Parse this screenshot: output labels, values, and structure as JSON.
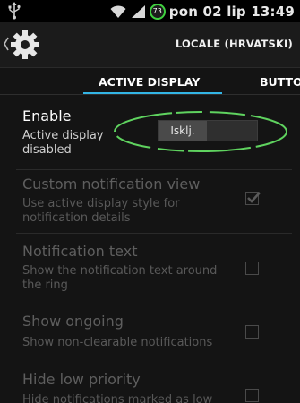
{
  "status": {
    "battery_level": "73",
    "clock": "pon 02 lip 13:49",
    "battery_color": "#3fd13f"
  },
  "actionbar": {
    "locale": "LOCALE (HRVATSKI)"
  },
  "tabs": [
    {
      "label": "ACTIVE DISPLAY",
      "active": true
    },
    {
      "label": "BUTTO",
      "active": false
    }
  ],
  "accent_color": "#33b5e5",
  "prefs": {
    "enable": {
      "title": "Enable",
      "summary": "Active display disabled",
      "switch_label": "Isklj."
    },
    "custom_view": {
      "title": "Custom notification view",
      "summary": "Use active display style for notification details",
      "checked": true,
      "enabled": false
    },
    "notification_text": {
      "title": "Notification text",
      "summary": "Show the notification text around the ring",
      "checked": false,
      "enabled": false
    },
    "show_ongoing": {
      "title": "Show ongoing",
      "summary": "Show non-clearable notifications",
      "checked": false,
      "enabled": false
    },
    "hide_low_priority": {
      "title": "Hide low priority",
      "summary": "Hide notifications marked as low",
      "checked": false,
      "enabled": false
    }
  }
}
